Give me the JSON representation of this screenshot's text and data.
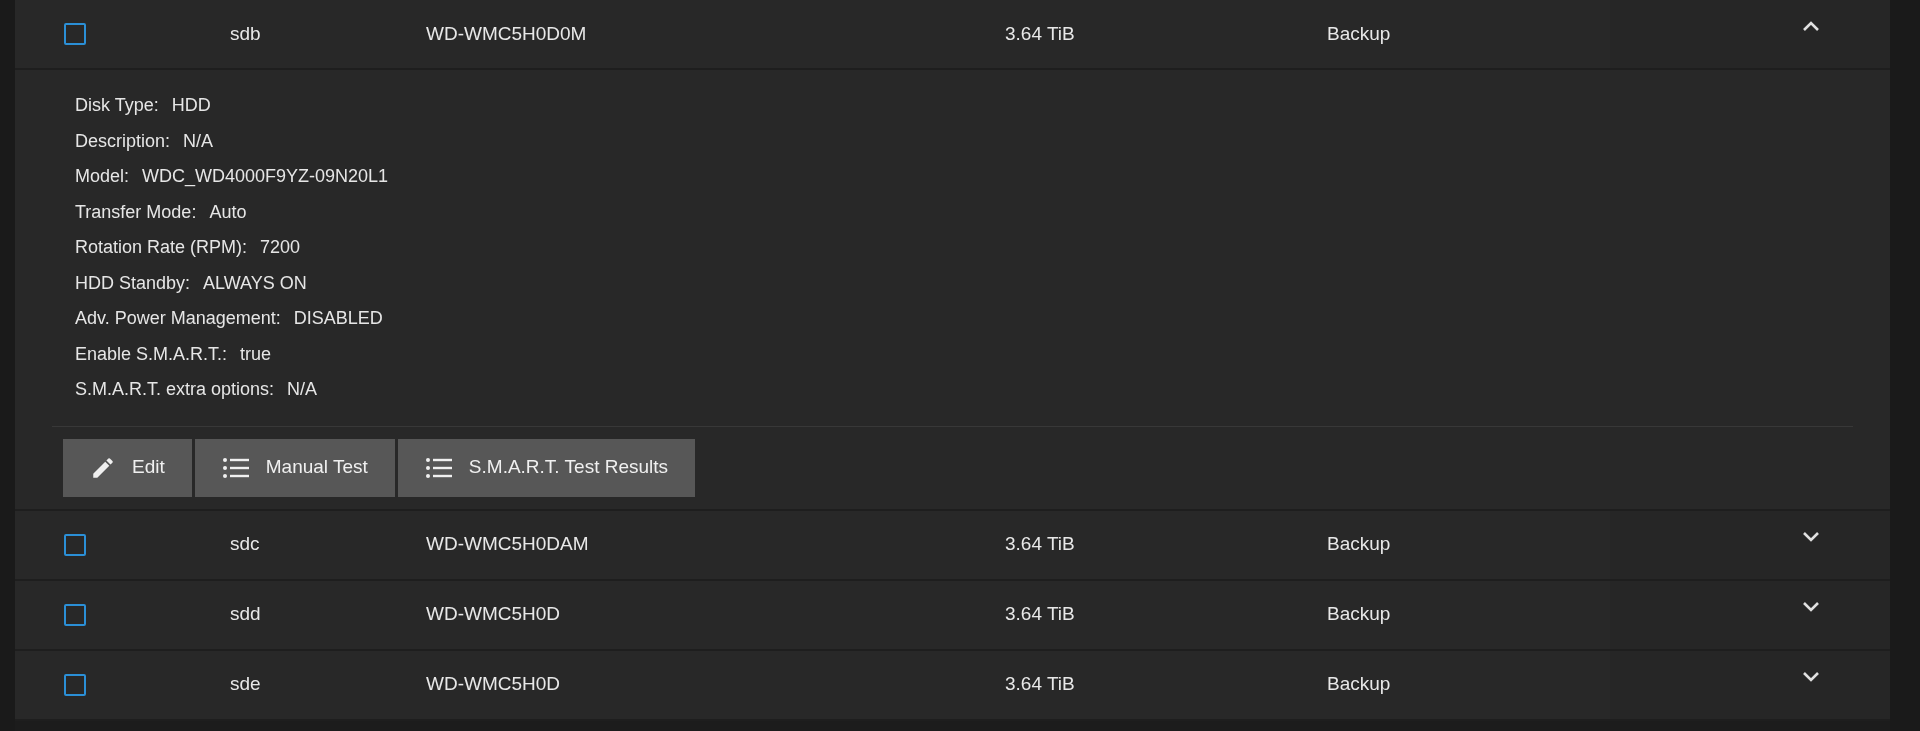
{
  "disks": [
    {
      "checked": false,
      "name": "sdb",
      "serial": "WD-WMC5H0D0M",
      "size": "3.64 TiB",
      "pool": "Backup",
      "expanded": true,
      "details": [
        {
          "label": "Disk Type:",
          "value": "HDD"
        },
        {
          "label": "Description:",
          "value": "N/A"
        },
        {
          "label": "Model:",
          "value": "WDC_WD4000F9YZ-09N20L1"
        },
        {
          "label": "Transfer Mode:",
          "value": "Auto"
        },
        {
          "label": "Rotation Rate (RPM):",
          "value": "7200"
        },
        {
          "label": "HDD Standby:",
          "value": "ALWAYS ON"
        },
        {
          "label": "Adv. Power Management:",
          "value": "DISABLED"
        },
        {
          "label": "Enable S.M.A.R.T.:",
          "value": "true"
        },
        {
          "label": "S.M.A.R.T. extra options:",
          "value": "N/A"
        }
      ],
      "actions": [
        {
          "kind": "edit",
          "label": "Edit"
        },
        {
          "kind": "list",
          "label": "Manual Test"
        },
        {
          "kind": "list",
          "label": "S.M.A.R.T. Test Results"
        }
      ]
    },
    {
      "checked": false,
      "name": "sdc",
      "serial": "WD-WMC5H0DAM",
      "size": "3.64 TiB",
      "pool": "Backup",
      "expanded": false
    },
    {
      "checked": false,
      "name": "sdd",
      "serial": "WD-WMC5H0D",
      "size": "3.64 TiB",
      "pool": "Backup",
      "expanded": false
    },
    {
      "checked": false,
      "name": "sde",
      "serial": "WD-WMC5H0D",
      "size": "3.64 TiB",
      "pool": "Backup",
      "expanded": false
    }
  ]
}
